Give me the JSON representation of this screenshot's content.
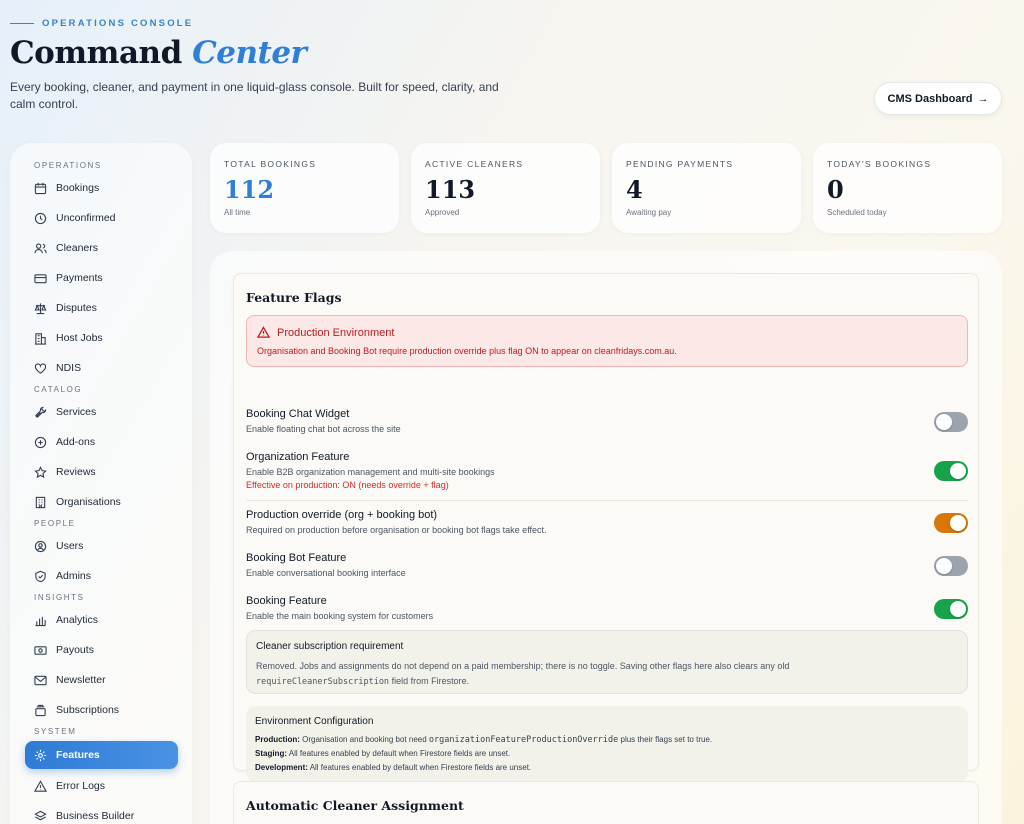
{
  "header": {
    "eyebrow": "OPERATIONS CONSOLE",
    "title_main": "Command",
    "title_accent": "Center",
    "subtitle": "Every booking, cleaner, and payment in one liquid-glass console. Built for speed, clarity, and calm control.",
    "cms_button": "CMS Dashboard",
    "cms_arrow": "→"
  },
  "sidebar": {
    "sections": [
      {
        "title": "OPERATIONS",
        "items": [
          {
            "label": "Bookings",
            "icon": "calendar-icon"
          },
          {
            "label": "Unconfirmed",
            "icon": "clock-icon"
          },
          {
            "label": "Cleaners",
            "icon": "users-icon"
          },
          {
            "label": "Payments",
            "icon": "credit-card-icon"
          },
          {
            "label": "Disputes",
            "icon": "scale-icon"
          },
          {
            "label": "Host Jobs",
            "icon": "building-icon"
          },
          {
            "label": "NDIS",
            "icon": "heart-icon"
          }
        ]
      },
      {
        "title": "CATALOG",
        "items": [
          {
            "label": "Services",
            "icon": "tools-icon"
          },
          {
            "label": "Add-ons",
            "icon": "plus-circle-icon"
          },
          {
            "label": "Reviews",
            "icon": "star-icon"
          },
          {
            "label": "Organisations",
            "icon": "office-icon"
          }
        ]
      },
      {
        "title": "PEOPLE",
        "items": [
          {
            "label": "Users",
            "icon": "user-circle-icon"
          },
          {
            "label": "Admins",
            "icon": "shield-icon"
          }
        ]
      },
      {
        "title": "INSIGHTS",
        "items": [
          {
            "label": "Analytics",
            "icon": "bar-chart-icon"
          },
          {
            "label": "Payouts",
            "icon": "banknote-icon"
          },
          {
            "label": "Newsletter",
            "icon": "mail-icon"
          },
          {
            "label": "Subscriptions",
            "icon": "stack-icon"
          }
        ]
      },
      {
        "title": "SYSTEM",
        "items": [
          {
            "label": "Features",
            "icon": "gear-icon",
            "active": true
          },
          {
            "label": "Error Logs",
            "icon": "warning-icon"
          },
          {
            "label": "Business Builder",
            "icon": "layers-icon"
          }
        ]
      }
    ]
  },
  "stats": [
    {
      "label": "TOTAL BOOKINGS",
      "value": "112",
      "sub": "All time"
    },
    {
      "label": "ACTIVE CLEANERS",
      "value": "113",
      "sub": "Approved"
    },
    {
      "label": "PENDING PAYMENTS",
      "value": "4",
      "sub": "Awaiting pay"
    },
    {
      "label": "TODAY'S BOOKINGS",
      "value": "0",
      "sub": "Scheduled today"
    }
  ],
  "feature_flags": {
    "title": "Feature Flags",
    "alert": {
      "title": "Production Environment",
      "desc": "Organisation and Booking Bot require production override plus flag ON to appear on cleanfridays.com.au."
    },
    "flags": [
      {
        "name": "Booking Chat Widget",
        "desc": "Enable floating chat bot across the site",
        "state": "off"
      },
      {
        "name": "Organization Feature",
        "desc": "Enable B2B organization management and multi-site bookings",
        "warn": "Effective on production: ON (needs override + flag)",
        "state": "on"
      },
      {
        "name": "Production override (org + booking bot)",
        "desc": "Required on production before organisation or booking bot flags take effect.",
        "state": "on"
      },
      {
        "name": "Booking Bot Feature",
        "desc": "Enable conversational booking interface",
        "state": "off"
      },
      {
        "name": "Booking Feature",
        "desc": "Enable the main booking system for customers",
        "state": "on"
      }
    ],
    "subscription": {
      "title": "Cleaner subscription requirement",
      "desc": "Removed. Jobs and assignments do not depend on a paid membership; there is no toggle. Saving other flags here also clears any old",
      "code": "requireCleanerSubscription",
      "desc_end": "field from Firestore."
    },
    "environment": {
      "title": "Environment Configuration",
      "production_label": "Production:",
      "production_text": "Organisation and booking bot need",
      "production_code": "organizationFeatureProductionOverride",
      "production_end": "plus their flags set to true.",
      "staging_label": "Staging:",
      "staging_text": "All features enabled by default when Firestore fields are unset.",
      "development_label": "Development:",
      "development_text": "All features enabled by default when Firestore fields are unset."
    }
  },
  "auto_assign": {
    "title": "Automatic Cleaner Assignment"
  },
  "colors": {
    "accent": "#2f7fd6",
    "toggle_on": "#16a34a",
    "toggle_override": "#d97706",
    "toggle_off": "#9ca3af",
    "alert": "#b91c1c"
  }
}
